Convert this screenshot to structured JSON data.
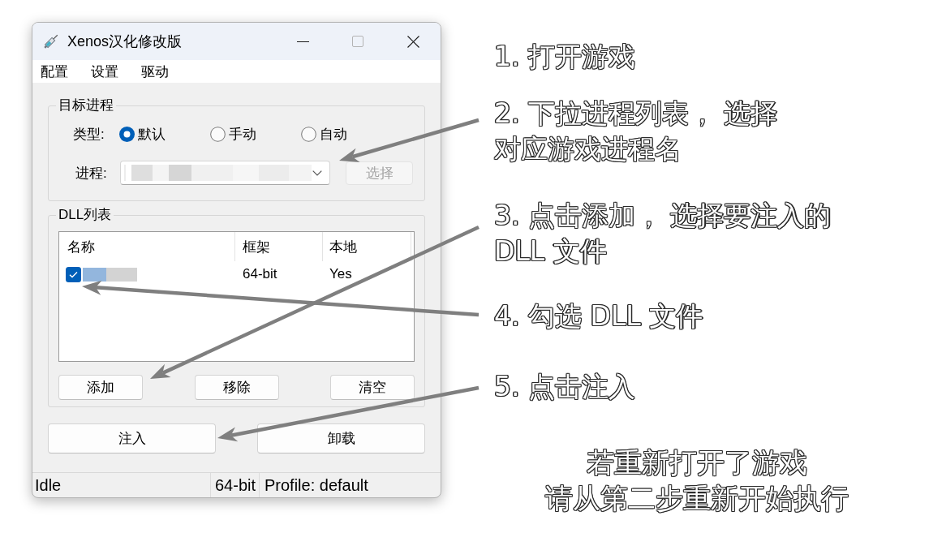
{
  "window": {
    "title": "Xenos汉化修改版",
    "controls": [
      {
        "kind": "minimize",
        "disabled": false
      },
      {
        "kind": "maximize",
        "disabled": true
      },
      {
        "kind": "close",
        "disabled": false
      }
    ]
  },
  "menu": [
    "配置",
    "设置",
    "驱动"
  ],
  "target_process": {
    "title": "目标进程",
    "type_label": "类型:",
    "types": [
      {
        "label": "默认",
        "selected": true
      },
      {
        "label": "手动",
        "selected": false
      },
      {
        "label": "自动",
        "selected": false
      }
    ],
    "process_label": "进程:",
    "select_button": {
      "label": "选择",
      "disabled": true
    }
  },
  "dll_list": {
    "title": "DLL列表",
    "columns": [
      "名称",
      "框架",
      "本地"
    ],
    "rows": [
      {
        "checked": true,
        "framework": "64-bit",
        "local": "Yes"
      }
    ],
    "buttons": [
      "添加",
      "移除",
      "清空"
    ]
  },
  "actions": [
    "注入",
    "卸载"
  ],
  "status_bar": [
    "Idle",
    "64-bit",
    "Profile: default"
  ],
  "steps": [
    {
      "lines": [
        "1. 打开游戏"
      ]
    },
    {
      "lines": [
        "2. 下拉进程列表， 选择",
        "对应游戏进程名"
      ]
    },
    {
      "lines": [
        "3. 点击添加， 选择要注入的",
        "DLL 文件"
      ]
    },
    {
      "lines": [
        "4. 勾选 DLL 文件"
      ]
    },
    {
      "lines": [
        "5. 点击注入"
      ]
    }
  ],
  "note": {
    "lines": [
      "若重新打开了游戏",
      "请从第二步重新开始执行"
    ]
  }
}
